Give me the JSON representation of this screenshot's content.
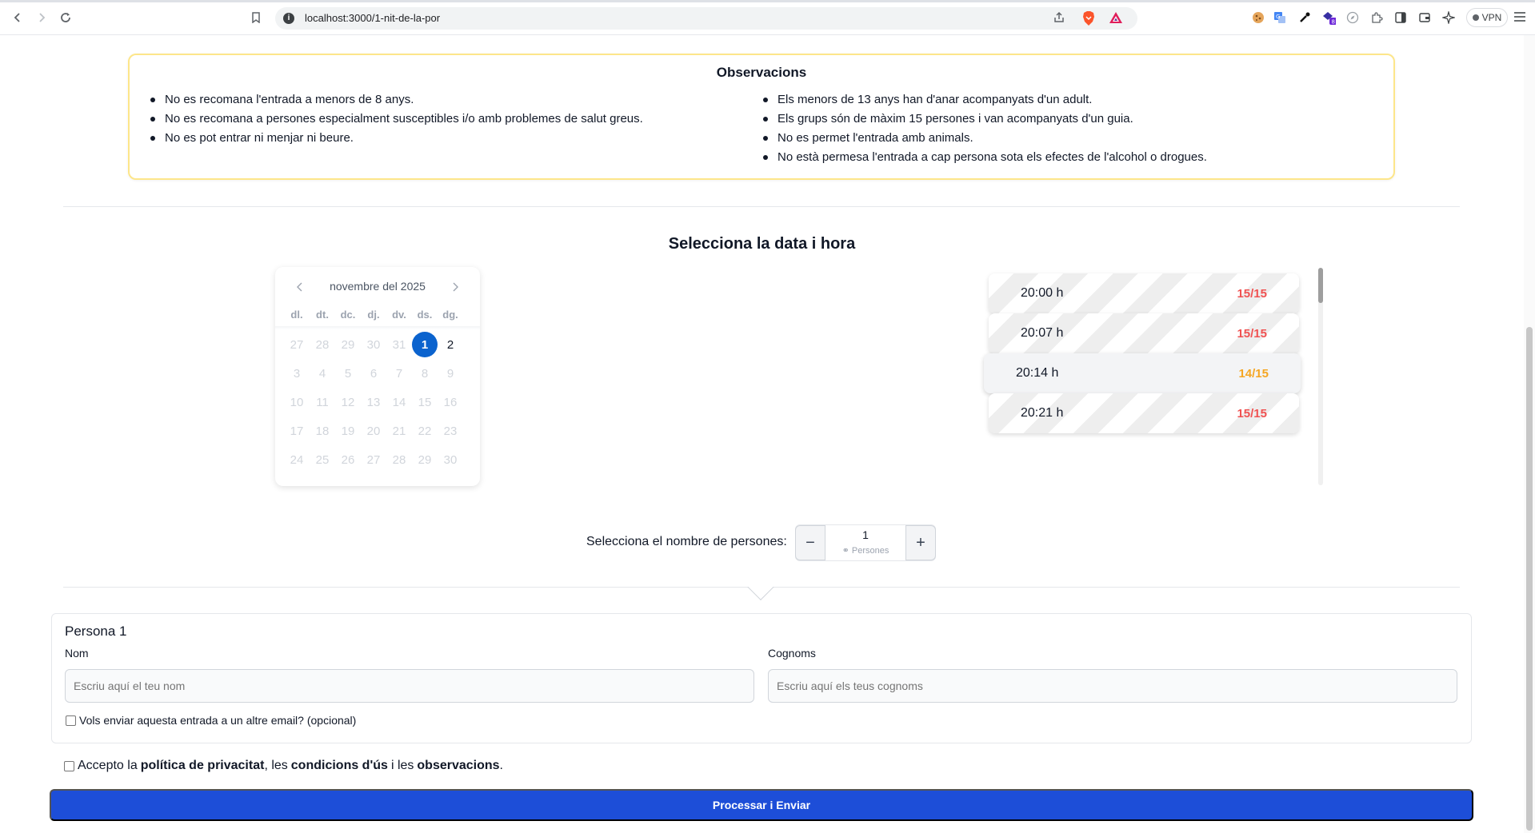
{
  "browser": {
    "url": "localhost:3000/1-nit-de-la-por",
    "vpn_label": "VPN"
  },
  "observations": {
    "title": "Observacions",
    "left_items": [
      "No es recomana l'entrada a menors de 8 anys.",
      "No es recomana a persones especialment susceptibles i/o amb problemes de salut greus.",
      "No es pot entrar ni menjar ni beure."
    ],
    "right_items": [
      "Els menors de 13 anys han d'anar acompanyats d'un adult.",
      "Els grups són de màxim 15 persones i van acompanyats d'un guia.",
      "No es permet l'entrada amb animals.",
      "No està permesa l'entrada a cap persona sota els efectes de l'alcohol o drogues."
    ]
  },
  "date_section": {
    "title": "Selecciona la data i hora"
  },
  "calendar": {
    "month_label": "novembre del 2025",
    "weekdays": [
      "dl.",
      "dt.",
      "dc.",
      "dj.",
      "dv.",
      "ds.",
      "dg."
    ],
    "weeks": [
      [
        "27",
        "28",
        "29",
        "30",
        "31",
        "1",
        "2"
      ],
      [
        "3",
        "4",
        "5",
        "6",
        "7",
        "8",
        "9"
      ],
      [
        "10",
        "11",
        "12",
        "13",
        "14",
        "15",
        "16"
      ],
      [
        "17",
        "18",
        "19",
        "20",
        "21",
        "22",
        "23"
      ],
      [
        "24",
        "25",
        "26",
        "27",
        "28",
        "29",
        "30"
      ]
    ],
    "selected_day": "1",
    "available_days": [
      "1",
      "2"
    ]
  },
  "time_slots": [
    {
      "time": "20:00 h",
      "count": "15/15",
      "full": true
    },
    {
      "time": "20:07 h",
      "count": "15/15",
      "full": true
    },
    {
      "time": "20:14 h",
      "count": "14/15",
      "full": false
    },
    {
      "time": "20:21 h",
      "count": "15/15",
      "full": true
    }
  ],
  "persons": {
    "label": "Selecciona el nombre de persones:",
    "value": "1",
    "unit": "Persones",
    "minus": "−",
    "plus": "+"
  },
  "person_form": {
    "title": "Persona 1",
    "name_label": "Nom",
    "name_placeholder": "Escriu aquí el teu nom",
    "surname_label": "Cognoms",
    "surname_placeholder": "Escriu aquí els teus cognoms",
    "other_email_label": "Vols enviar aquesta entrada a un altre email? (opcional)"
  },
  "consent": {
    "prefix": "Accepto la",
    "privacy": "política de privacitat",
    "sep1": ", les",
    "terms": "condicions d'ús",
    "sep2": "i les",
    "observations": "observacions",
    "suffix": "."
  },
  "submit_label": "Processar i Enviar",
  "colors": {
    "primary": "#1d4ed8",
    "selected_day": "#0b63ce",
    "full_count": "#f05252",
    "available_count": "#f5a623",
    "observations_border": "#fde68a"
  }
}
